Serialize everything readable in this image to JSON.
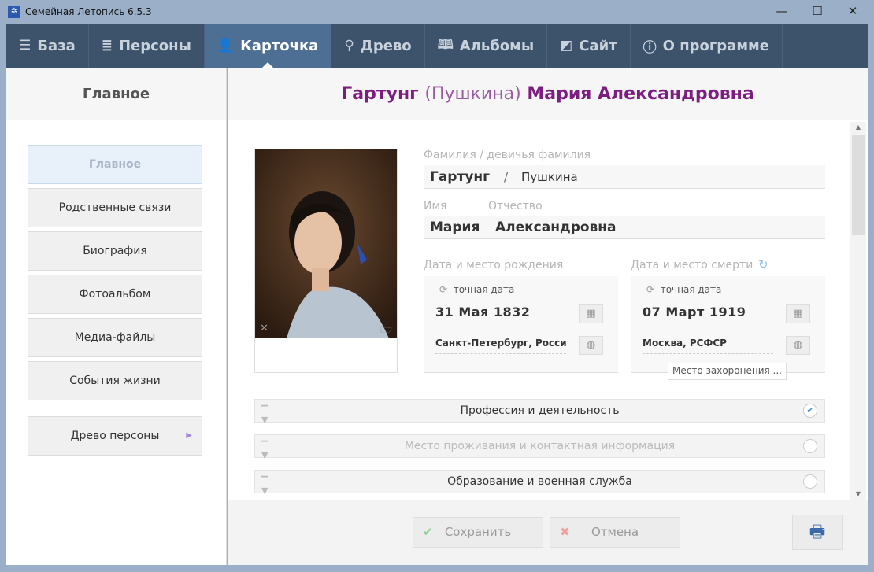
{
  "window": {
    "title": "Семейная Летопись  6.5.3",
    "minimize": "—",
    "maximize": "☐",
    "close": "✕"
  },
  "nav": {
    "tabs": [
      {
        "label": "База",
        "icon": "database-icon",
        "glyph": "☰",
        "active": false
      },
      {
        "label": "Персоны",
        "icon": "list-icon",
        "glyph": "≣",
        "active": false
      },
      {
        "label": "Карточка",
        "icon": "person-icon",
        "glyph": "👤",
        "active": true
      },
      {
        "label": "Древо",
        "icon": "tree-icon",
        "glyph": "⚲",
        "active": false
      },
      {
        "label": "Альбомы",
        "icon": "book-icon",
        "glyph": "🕮",
        "active": false
      },
      {
        "label": "Сайт",
        "icon": "site-icon",
        "glyph": "◩",
        "active": false
      },
      {
        "label": "О программе",
        "icon": "info-icon",
        "glyph": "ⓘ",
        "active": false
      }
    ]
  },
  "sidebar": {
    "title": "Главное",
    "items": [
      {
        "label": "Главное",
        "active": true
      },
      {
        "label": "Родственные связи"
      },
      {
        "label": "Биография"
      },
      {
        "label": "Фотоальбом"
      },
      {
        "label": "Медиа-файлы"
      },
      {
        "label": "События жизни"
      },
      {
        "label": "Древо персоны"
      }
    ]
  },
  "person": {
    "surname": "Гартунг",
    "maiden": "(Пушкина)",
    "name_patronymic": "Мария Александровна"
  },
  "form": {
    "surname_label": "Фамилия / девичья фамилия",
    "surname": "Гартунг",
    "separator": "/",
    "maiden": "Пушкина",
    "name_label": "Имя",
    "name": "Мария",
    "patronymic_label": "Отчество",
    "patronymic": "Александровна",
    "birth": {
      "label": "Дата и место рождения",
      "exact": "точная дата",
      "date": "31  Мая  1832",
      "place": "Санкт-Петербург, Россия"
    },
    "death": {
      "label": "Дата и место смерти",
      "exact": "точная дата",
      "date": "07  Март  1919",
      "place": "Москва, РСФСР",
      "burial": "Место захоронения ..."
    }
  },
  "sections": [
    {
      "label": "Профессия и деятельность",
      "checked": true,
      "enabled": true
    },
    {
      "label": "Место проживания и контактная информация",
      "checked": false,
      "enabled": false
    },
    {
      "label": "Образование и военная служба",
      "checked": false,
      "enabled": true
    }
  ],
  "footer": {
    "save": "Сохранить",
    "cancel": "Отмена"
  },
  "colors": {
    "accent": "#7d1d82",
    "nav": "#3d526b",
    "nav_active": "#4c6f93"
  }
}
